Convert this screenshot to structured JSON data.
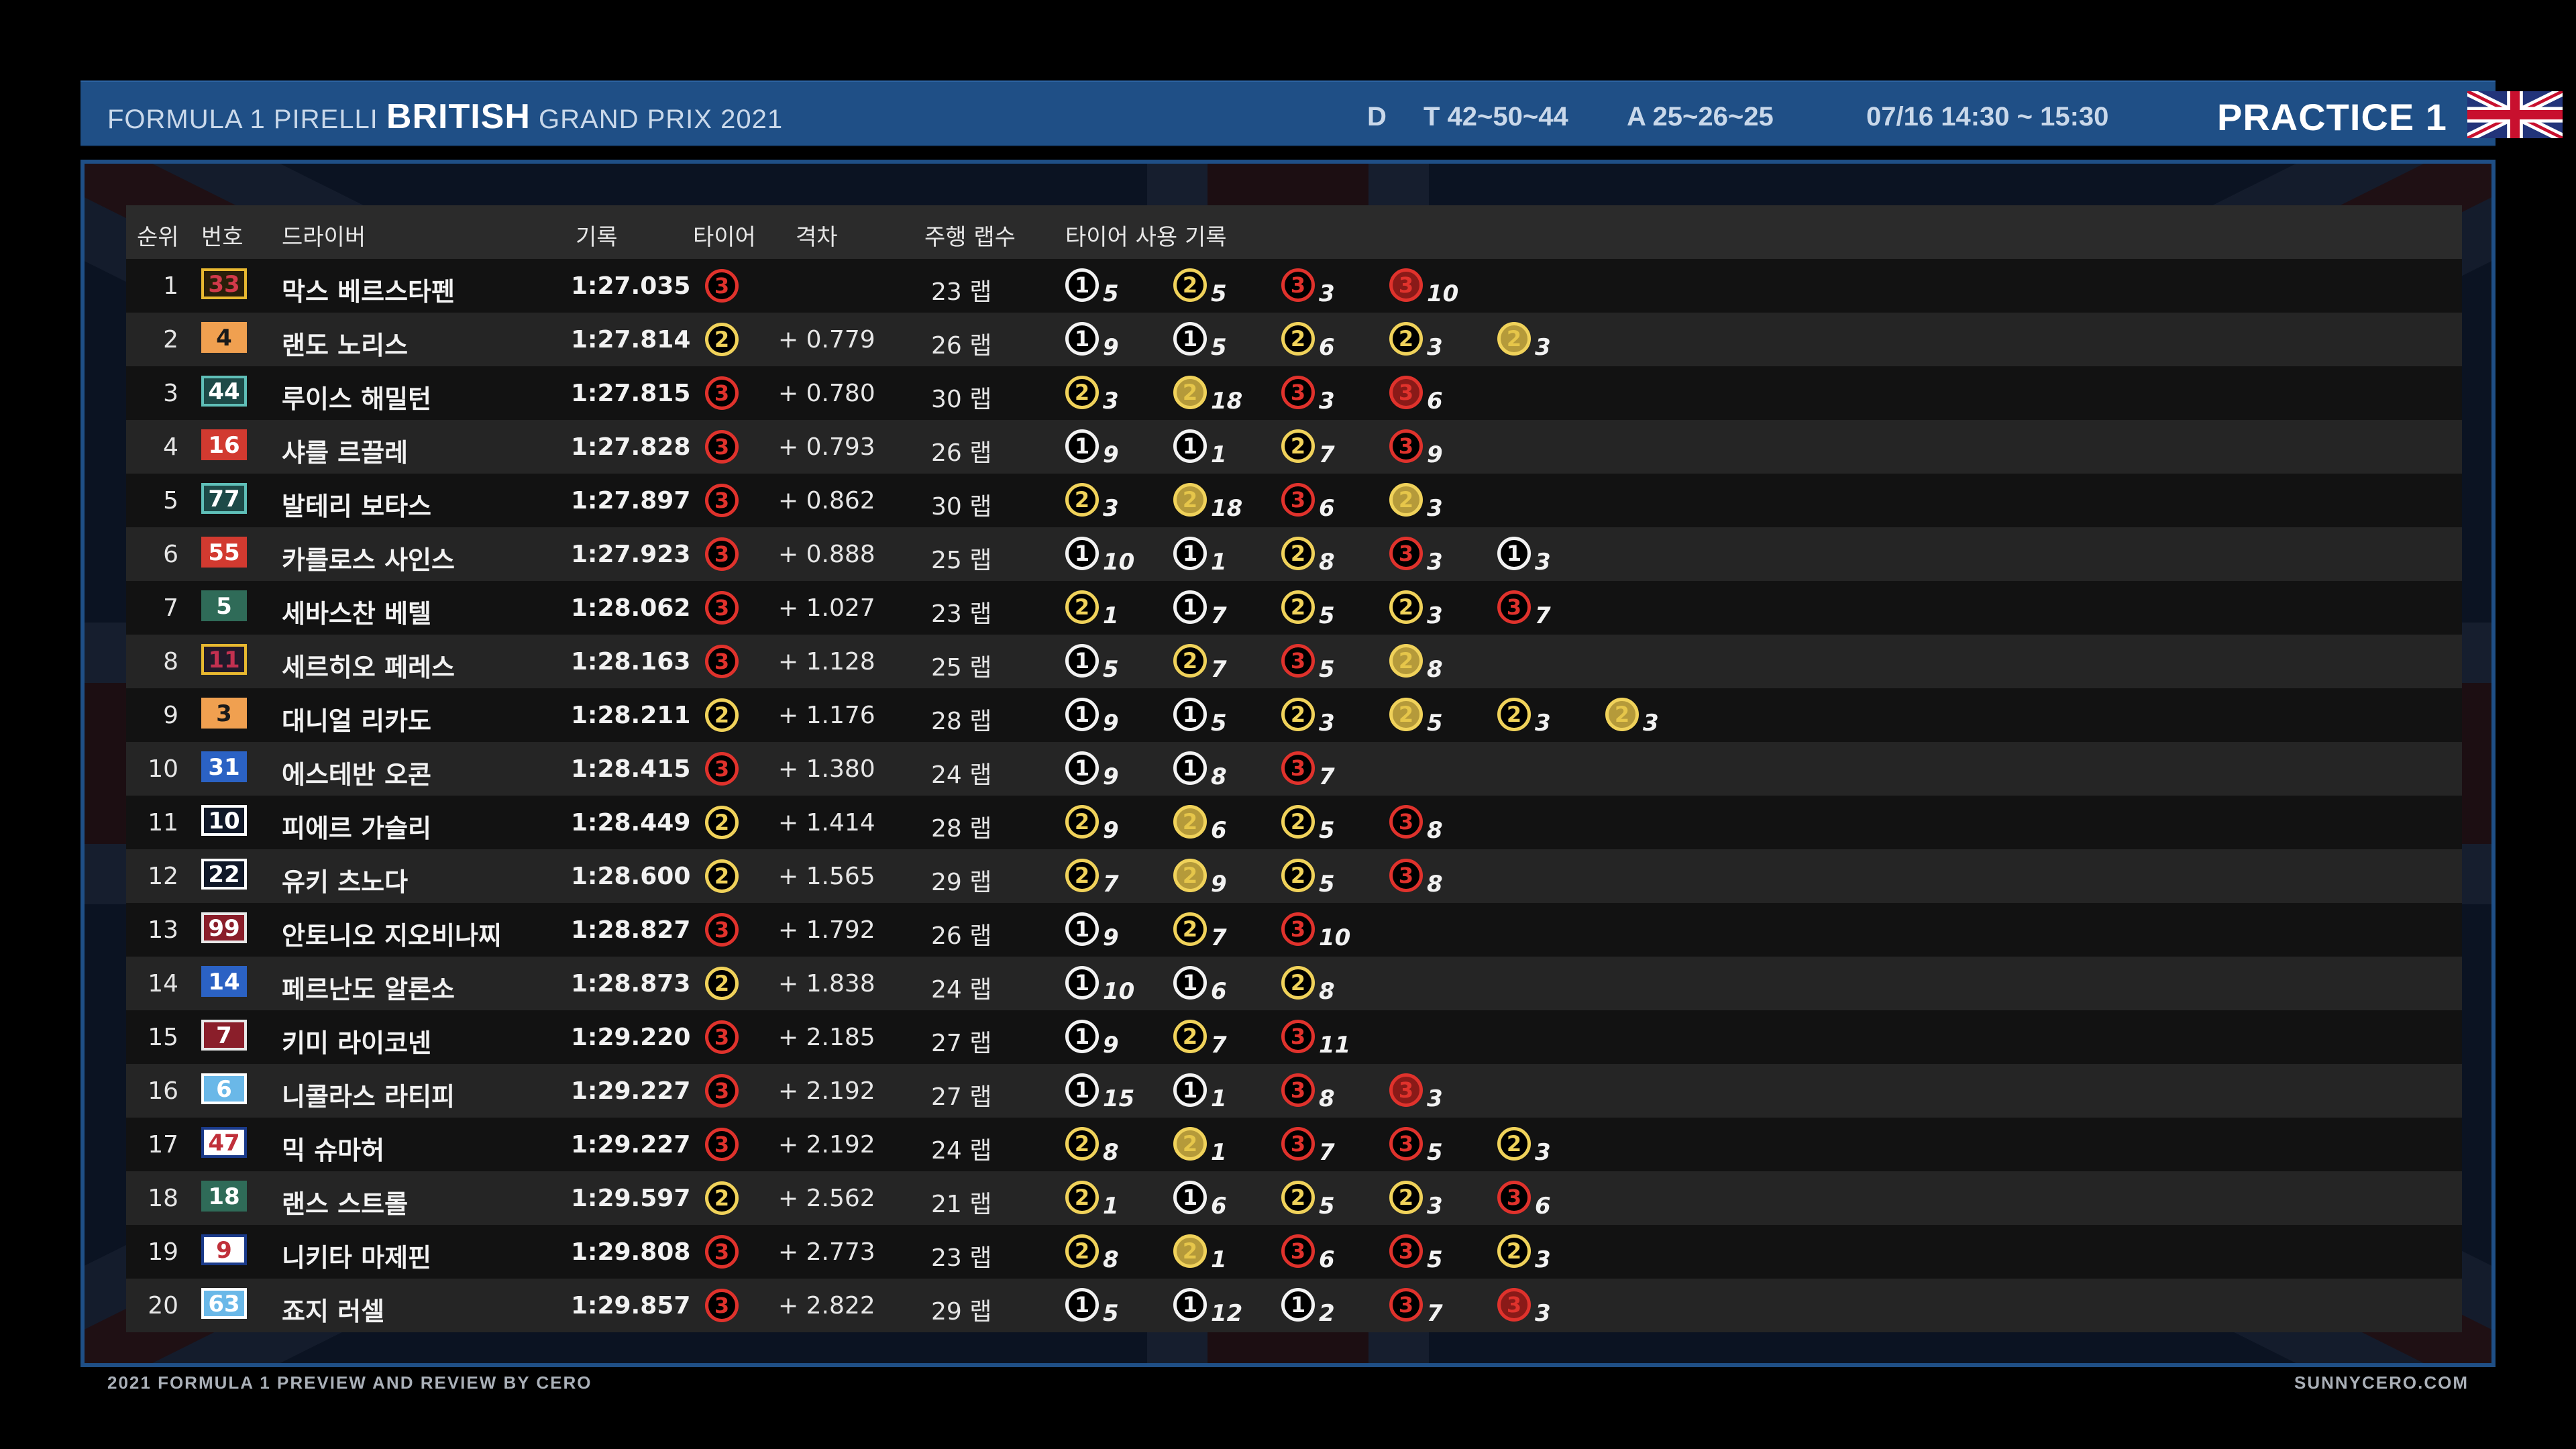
{
  "header": {
    "title_prefix": "FORMULA 1 PIRELLI",
    "title_bold": "BRITISH",
    "title_suffix": "GRAND PRIX 2021",
    "d_label": "D",
    "track_temp": "T 42~50~44",
    "air_temp": "A 25~26~25",
    "datetime": "07/16 14:30 ~ 15:30",
    "session": "PRACTICE 1",
    "flag_icon": "union-jack-flag-icon"
  },
  "columns": {
    "pos": "순위",
    "num": "번호",
    "driver": "드라이버",
    "time": "기록",
    "tyre": "타이어",
    "gap": "격차",
    "laps": "주행 랩수",
    "stints": "타이어 사용 기록"
  },
  "tyre_colors": {
    "hard": "#f2f2f2",
    "medium": "#f0d25a",
    "soft": "#e0322c"
  },
  "rows": [
    {
      "pos": "1",
      "num": "33",
      "color": "#d23a4a",
      "bg": "#2a1f0a",
      "border": "#e8b830",
      "name": "막스 베르스타펜",
      "time": "1:27.035",
      "tyre": "3",
      "gap": "",
      "laps": "23 랩",
      "stints": [
        {
          "c": "1",
          "n": "5"
        },
        {
          "c": "2",
          "n": "5"
        },
        {
          "c": "3",
          "n": "3"
        },
        {
          "c": "3f",
          "n": "10"
        }
      ]
    },
    {
      "pos": "2",
      "num": "4",
      "color": "#1a1a1a",
      "bg": "#f0a050",
      "border": "#f0a050",
      "name": "랜도 노리스",
      "time": "1:27.814",
      "tyre": "2",
      "gap": "+ 0.779",
      "laps": "26 랩",
      "stints": [
        {
          "c": "1",
          "n": "9"
        },
        {
          "c": "1f",
          "n": "5"
        },
        {
          "c": "2",
          "n": "6"
        },
        {
          "c": "2",
          "n": "3"
        },
        {
          "c": "2f",
          "n": "3"
        }
      ]
    },
    {
      "pos": "3",
      "num": "44",
      "color": "#ffffff",
      "bg": "#1d4a48",
      "border": "#5fbfb8",
      "name": "루이스 해밀턴",
      "time": "1:27.815",
      "tyre": "3",
      "gap": "+ 0.780",
      "laps": "30 랩",
      "stints": [
        {
          "c": "2",
          "n": "3"
        },
        {
          "c": "2f",
          "n": "18"
        },
        {
          "c": "3",
          "n": "3"
        },
        {
          "c": "3f",
          "n": "6"
        }
      ]
    },
    {
      "pos": "4",
      "num": "16",
      "color": "#ffffff",
      "bg": "#d23a30",
      "border": "#d23a30",
      "name": "샤를 르끌레",
      "time": "1:27.828",
      "tyre": "3",
      "gap": "+ 0.793",
      "laps": "26 랩",
      "stints": [
        {
          "c": "1",
          "n": "9"
        },
        {
          "c": "1",
          "n": "1"
        },
        {
          "c": "2",
          "n": "7"
        },
        {
          "c": "3",
          "n": "9"
        }
      ]
    },
    {
      "pos": "5",
      "num": "77",
      "color": "#ffffff",
      "bg": "#1d4a48",
      "border": "#5fbfb8",
      "name": "발테리 보타스",
      "time": "1:27.897",
      "tyre": "3",
      "gap": "+ 0.862",
      "laps": "30 랩",
      "stints": [
        {
          "c": "2",
          "n": "3"
        },
        {
          "c": "2f",
          "n": "18"
        },
        {
          "c": "3",
          "n": "6"
        },
        {
          "c": "2f",
          "n": "3"
        }
      ]
    },
    {
      "pos": "6",
      "num": "55",
      "color": "#ffffff",
      "bg": "#d23a30",
      "border": "#d23a30",
      "name": "카를로스 사인스",
      "time": "1:27.923",
      "tyre": "3",
      "gap": "+ 0.888",
      "laps": "25 랩",
      "stints": [
        {
          "c": "1",
          "n": "10"
        },
        {
          "c": "1f",
          "n": "1"
        },
        {
          "c": "2",
          "n": "8"
        },
        {
          "c": "3",
          "n": "3"
        },
        {
          "c": "1f",
          "n": "3"
        }
      ]
    },
    {
      "pos": "7",
      "num": "5",
      "color": "#ffffff",
      "bg": "#2f6b58",
      "border": "#2f6b58",
      "name": "세바스찬 베텔",
      "time": "1:28.062",
      "tyre": "3",
      "gap": "+ 1.027",
      "laps": "23 랩",
      "stints": [
        {
          "c": "2",
          "n": "1"
        },
        {
          "c": "1",
          "n": "7"
        },
        {
          "c": "2",
          "n": "5"
        },
        {
          "c": "2",
          "n": "3"
        },
        {
          "c": "3",
          "n": "7"
        }
      ]
    },
    {
      "pos": "8",
      "num": "11",
      "color": "#c23050",
      "bg": "#221a2a",
      "border": "#e8b830",
      "name": "세르히오 페레스",
      "time": "1:28.163",
      "tyre": "3",
      "gap": "+ 1.128",
      "laps": "25 랩",
      "stints": [
        {
          "c": "1",
          "n": "5"
        },
        {
          "c": "2",
          "n": "7"
        },
        {
          "c": "3",
          "n": "5"
        },
        {
          "c": "2f",
          "n": "8"
        }
      ]
    },
    {
      "pos": "9",
      "num": "3",
      "color": "#1a1a1a",
      "bg": "#f0a050",
      "border": "#f0a050",
      "name": "대니얼 리카도",
      "time": "1:28.211",
      "tyre": "2",
      "gap": "+ 1.176",
      "laps": "28 랩",
      "stints": [
        {
          "c": "1",
          "n": "9"
        },
        {
          "c": "1f",
          "n": "5"
        },
        {
          "c": "2",
          "n": "3"
        },
        {
          "c": "2f",
          "n": "5"
        },
        {
          "c": "2",
          "n": "3"
        },
        {
          "c": "2f",
          "n": "3"
        }
      ]
    },
    {
      "pos": "10",
      "num": "31",
      "color": "#ffffff",
      "bg": "#2b62c4",
      "border": "#2b62c4",
      "name": "에스테반 오콘",
      "time": "1:28.415",
      "tyre": "3",
      "gap": "+ 1.380",
      "laps": "24 랩",
      "stints": [
        {
          "c": "1",
          "n": "9"
        },
        {
          "c": "1f",
          "n": "8"
        },
        {
          "c": "3",
          "n": "7"
        }
      ]
    },
    {
      "pos": "11",
      "num": "10",
      "color": "#ffffff",
      "bg": "#101828",
      "border": "#ffffff",
      "name": "피에르 가슬리",
      "time": "1:28.449",
      "tyre": "2",
      "gap": "+ 1.414",
      "laps": "28 랩",
      "stints": [
        {
          "c": "2",
          "n": "9"
        },
        {
          "c": "2f",
          "n": "6"
        },
        {
          "c": "2",
          "n": "5"
        },
        {
          "c": "3",
          "n": "8"
        }
      ]
    },
    {
      "pos": "12",
      "num": "22",
      "color": "#ffffff",
      "bg": "#101828",
      "border": "#ffffff",
      "name": "유키 츠노다",
      "time": "1:28.600",
      "tyre": "2",
      "gap": "+ 1.565",
      "laps": "29 랩",
      "stints": [
        {
          "c": "2",
          "n": "7"
        },
        {
          "c": "2f",
          "n": "9"
        },
        {
          "c": "2",
          "n": "5"
        },
        {
          "c": "3",
          "n": "8"
        }
      ]
    },
    {
      "pos": "13",
      "num": "99",
      "color": "#ffffff",
      "bg": "#8a1e2a",
      "border": "#e8e8e8",
      "name": "안토니오 지오비나찌",
      "time": "1:28.827",
      "tyre": "3",
      "gap": "+ 1.792",
      "laps": "26 랩",
      "stints": [
        {
          "c": "1",
          "n": "9"
        },
        {
          "c": "2",
          "n": "7"
        },
        {
          "c": "3",
          "n": "10"
        }
      ]
    },
    {
      "pos": "14",
      "num": "14",
      "color": "#ffffff",
      "bg": "#2b62c4",
      "border": "#2b62c4",
      "name": "페르난도 알론소",
      "time": "1:28.873",
      "tyre": "2",
      "gap": "+ 1.838",
      "laps": "24 랩",
      "stints": [
        {
          "c": "1",
          "n": "10"
        },
        {
          "c": "1f",
          "n": "6"
        },
        {
          "c": "2",
          "n": "8"
        }
      ]
    },
    {
      "pos": "15",
      "num": "7",
      "color": "#ffffff",
      "bg": "#8a1e2a",
      "border": "#e8e8e8",
      "name": "키미 라이코넨",
      "time": "1:29.220",
      "tyre": "3",
      "gap": "+ 2.185",
      "laps": "27 랩",
      "stints": [
        {
          "c": "1",
          "n": "9"
        },
        {
          "c": "2",
          "n": "7"
        },
        {
          "c": "3",
          "n": "11"
        }
      ]
    },
    {
      "pos": "16",
      "num": "6",
      "color": "#ffffff",
      "bg": "#6ab8e8",
      "border": "#ffffff",
      "name": "니콜라스 라티피",
      "time": "1:29.227",
      "tyre": "3",
      "gap": "+ 2.192",
      "laps": "27 랩",
      "stints": [
        {
          "c": "1",
          "n": "15"
        },
        {
          "c": "1f",
          "n": "1"
        },
        {
          "c": "3",
          "n": "8"
        },
        {
          "c": "3f",
          "n": "3"
        }
      ]
    },
    {
      "pos": "17",
      "num": "47",
      "color": "#c0303a",
      "bg": "#ffffff",
      "border": "#1a3a8a",
      "name": "믹 슈마허",
      "time": "1:29.227",
      "tyre": "3",
      "gap": "+ 2.192",
      "laps": "24 랩",
      "stints": [
        {
          "c": "2",
          "n": "8"
        },
        {
          "c": "2f",
          "n": "1"
        },
        {
          "c": "3",
          "n": "7"
        },
        {
          "c": "3",
          "n": "5"
        },
        {
          "c": "2",
          "n": "3"
        }
      ]
    },
    {
      "pos": "18",
      "num": "18",
      "color": "#ffffff",
      "bg": "#2f6b58",
      "border": "#2f6b58",
      "name": "랜스 스트롤",
      "time": "1:29.597",
      "tyre": "2",
      "gap": "+ 2.562",
      "laps": "21 랩",
      "stints": [
        {
          "c": "2",
          "n": "1"
        },
        {
          "c": "1",
          "n": "6"
        },
        {
          "c": "2",
          "n": "5"
        },
        {
          "c": "2",
          "n": "3"
        },
        {
          "c": "3",
          "n": "6"
        }
      ]
    },
    {
      "pos": "19",
      "num": "9",
      "color": "#c0303a",
      "bg": "#ffffff",
      "border": "#1a3a8a",
      "name": "니키타 마제핀",
      "time": "1:29.808",
      "tyre": "3",
      "gap": "+ 2.773",
      "laps": "23 랩",
      "stints": [
        {
          "c": "2",
          "n": "8"
        },
        {
          "c": "2f",
          "n": "1"
        },
        {
          "c": "3",
          "n": "6"
        },
        {
          "c": "3",
          "n": "5"
        },
        {
          "c": "2",
          "n": "3"
        }
      ]
    },
    {
      "pos": "20",
      "num": "63",
      "color": "#ffffff",
      "bg": "#6ab8e8",
      "border": "#ffffff",
      "name": "죠지 러셀",
      "time": "1:29.857",
      "tyre": "3",
      "gap": "+ 2.822",
      "laps": "29 랩",
      "stints": [
        {
          "c": "1",
          "n": "5"
        },
        {
          "c": "1f",
          "n": "12"
        },
        {
          "c": "1f",
          "n": "2"
        },
        {
          "c": "3",
          "n": "7"
        },
        {
          "c": "3f",
          "n": "3"
        }
      ]
    }
  ],
  "footer": {
    "left": "2021 FORMULA 1 PREVIEW AND REVIEW BY CERO",
    "right": "SUNNYCERO.COM"
  }
}
